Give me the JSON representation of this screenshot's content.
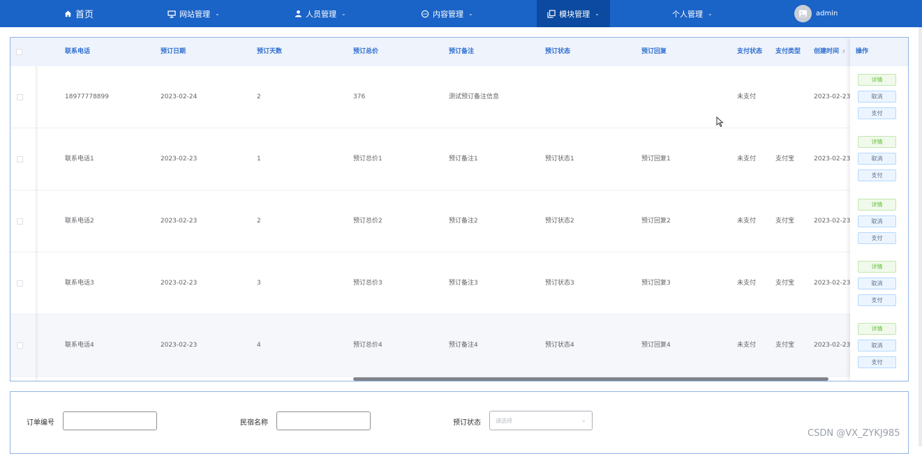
{
  "nav": {
    "home": "首页",
    "website": "网站管理",
    "people": "人员管理",
    "content": "内容管理",
    "module": "模块管理",
    "personal": "个人管理",
    "user": "admin",
    "active_color": "#0b4aa0",
    "bar_color": "#1a63c7"
  },
  "table": {
    "headers": [
      "联系电话",
      "预订日期",
      "预订天数",
      "预订总价",
      "预订备注",
      "预订状态",
      "预订回复",
      "支付状态",
      "支付类型",
      "创建时间",
      "操作"
    ],
    "rows": [
      [
        "18977778899",
        "2023-02-24",
        "2",
        "376",
        "测试预订备注信息",
        "",
        "",
        "未支付",
        "",
        "2023-02-23"
      ],
      [
        "联系电话1",
        "2023-02-23",
        "1",
        "预订总价1",
        "预订备注1",
        "预订状态1",
        "预订回复1",
        "未支付",
        "支付宝",
        "2023-02-23"
      ],
      [
        "联系电话2",
        "2023-02-23",
        "2",
        "预订总价2",
        "预订备注2",
        "预订状态2",
        "预订回复2",
        "未支付",
        "支付宝",
        "2023-02-23"
      ],
      [
        "联系电话3",
        "2023-02-23",
        "3",
        "预订总价3",
        "预订备注3",
        "预订状态3",
        "预订回复3",
        "未支付",
        "支付宝",
        "2023-02-23"
      ],
      [
        "联系电话4",
        "2023-02-23",
        "4",
        "预订总价4",
        "预订备注4",
        "预订状态4",
        "预订回复4",
        "未支付",
        "支付宝",
        "2023-02-23"
      ]
    ],
    "actions": {
      "detail": "详情",
      "cancel": "取消",
      "pay": "支付"
    },
    "sort_glyph": "⇕"
  },
  "search": {
    "order_no_label": "订单编号",
    "homestay_label": "民宿名称",
    "status_label": "预订状态",
    "status_placeholder": "请选择"
  },
  "watermark": "CSDN @VX_ZYKJ985"
}
